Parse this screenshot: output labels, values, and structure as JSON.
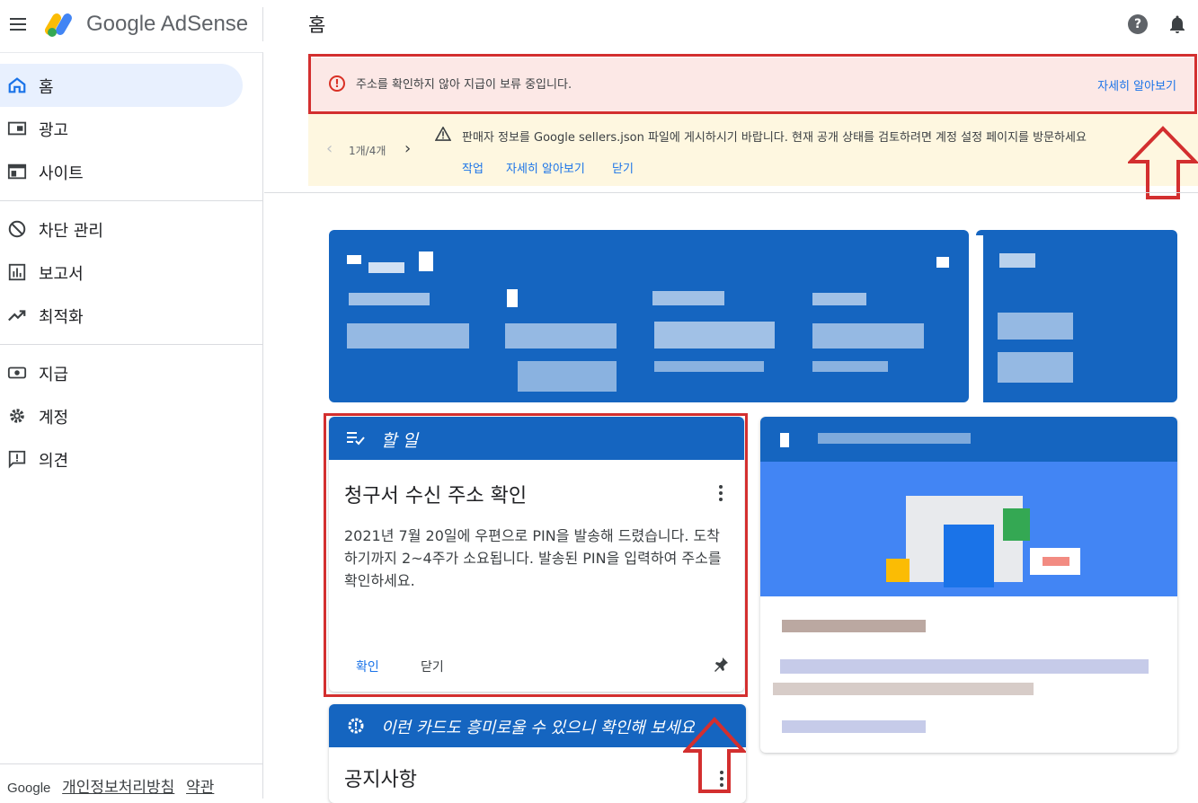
{
  "header": {
    "brand": "Google AdSense",
    "page_title": "홈",
    "help_glyph": "?"
  },
  "sidebar": {
    "items": [
      {
        "label": "홈",
        "icon": "home-icon",
        "active": true
      },
      {
        "label": "광고",
        "icon": "ads-icon"
      },
      {
        "label": "사이트",
        "icon": "sites-icon"
      },
      {
        "label": "차단 관리",
        "icon": "block-icon"
      },
      {
        "label": "보고서",
        "icon": "reports-icon"
      },
      {
        "label": "최적화",
        "icon": "trending-icon"
      },
      {
        "label": "지급",
        "icon": "payments-icon"
      },
      {
        "label": "계정",
        "icon": "gear-icon"
      },
      {
        "label": "의견",
        "icon": "feedback-icon"
      }
    ],
    "footer": {
      "google": "Google",
      "privacy": "개인정보처리방침",
      "terms": "약관"
    }
  },
  "alerts": {
    "payment_hold": {
      "icon_glyph": "!",
      "message": "주소를 확인하지 않아 지급이 보류 중입니다.",
      "link": "자세히 알아보기"
    },
    "sellers_json": {
      "pager": "1개/4개",
      "message": "판매자 정보를 Google sellers.json 파일에 게시하시기 바랍니다. 현재 공개 상태를 검토하려면 계정 설정 페이지를 방문하세요",
      "actions": [
        "작업",
        "자세히 알아보기",
        "닫기"
      ]
    }
  },
  "todo_card": {
    "header": "할 일",
    "title": "청구서 수신 주소 확인",
    "body": "2021년 7월 20일에 우편으로 PIN을 발송해 드렸습니다. 도착하기까지 2~4주가 소요됩니다. 발송된 PIN을 입력하여 주소를 확인하세요.",
    "confirm": "확인",
    "close": "닫기"
  },
  "suggest_card": {
    "header": "이런 카드도 흥미로울 수 있으니 확인해 보세요",
    "title": "공지사항"
  },
  "colors": {
    "accent_blue": "#1565c0",
    "link_blue": "#1a73e8",
    "error_red": "#d93025",
    "annotation_red": "#d32f2f"
  }
}
